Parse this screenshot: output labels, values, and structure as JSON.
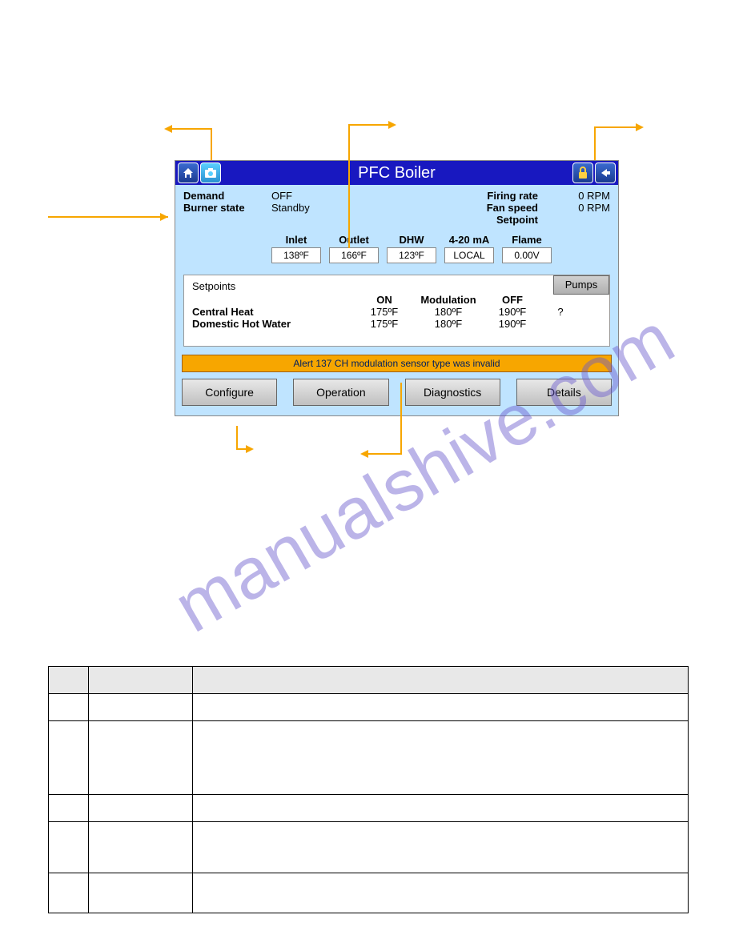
{
  "watermark": "manualshive.com",
  "titlebar": {
    "title": "PFC Boiler"
  },
  "status": {
    "demand_label": "Demand",
    "demand_value": "OFF",
    "burner_label": "Burner state",
    "burner_value": "Standby",
    "firing_label": "Firing rate",
    "firing_value": "0 RPM",
    "fan_label": "Fan speed",
    "fan_value": "0 RPM",
    "setpoint_label": "Setpoint"
  },
  "readings": {
    "headers": [
      "Inlet",
      "Outlet",
      "DHW",
      "4-20 mA",
      "Flame"
    ],
    "values": [
      "138ºF",
      "166ºF",
      "123ºF",
      "LOCAL",
      "0.00V"
    ]
  },
  "setpoints": {
    "title": "Setpoints",
    "pumps": "Pumps",
    "cols": [
      "ON",
      "Modulation",
      "OFF"
    ],
    "rows": [
      {
        "name": "Central Heat",
        "on": "175ºF",
        "mod": "180ºF",
        "off": "190ºF",
        "extra": "?"
      },
      {
        "name": "Domestic Hot Water",
        "on": "175ºF",
        "mod": "180ºF",
        "off": "190ºF",
        "extra": ""
      }
    ]
  },
  "alert": "Alert 137 CH modulation sensor type was invalid",
  "buttons": {
    "configure": "Configure",
    "operation": "Operation",
    "diagnostics": "Diagnostics",
    "details": "Details"
  }
}
